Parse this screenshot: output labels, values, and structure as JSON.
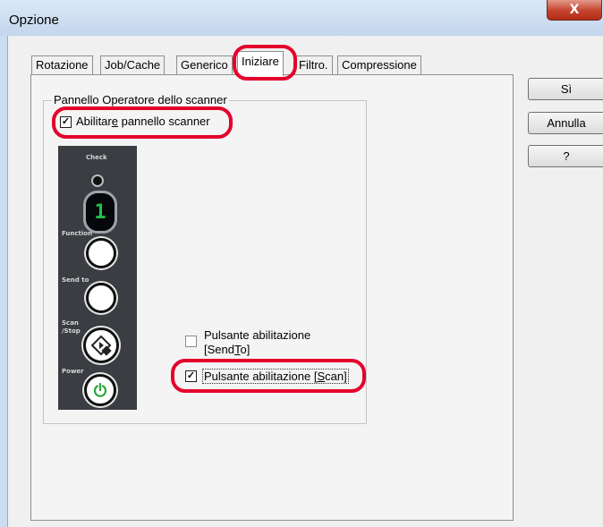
{
  "window": {
    "title": "Opzione",
    "close_glyph": "X"
  },
  "tabs": [
    {
      "label": "Rotazione",
      "active": false
    },
    {
      "label": "Job/Cache",
      "active": false
    },
    {
      "label": "Generico",
      "active": false
    },
    {
      "label": "Iniziare",
      "active": true
    },
    {
      "label": "Filtro.",
      "active": false
    },
    {
      "label": "Compressione",
      "active": false
    }
  ],
  "group": {
    "title": "Pannello Operatore dello scanner",
    "enable_panel": {
      "label_pre": "Abilitar",
      "label_mn": "e",
      "label_post": " pannello scanner",
      "checked": true
    }
  },
  "scanner_panel": {
    "labels": {
      "check": "Check",
      "function": "Function",
      "send_to": "Send to",
      "scan_stop_1": "Scan",
      "scan_stop_2": "/Stop",
      "power": "Power"
    },
    "display_digit": "1",
    "display_color": "#22c04a",
    "power_color": "#29a83c"
  },
  "options": {
    "sendto": {
      "line1": "Pulsante abilitazione",
      "line2_pre": "[Send",
      "line2_mn": "T",
      "line2_post": "o]",
      "checked": false
    },
    "scan": {
      "label_pre": "Pulsante abilitazione [",
      "label_mn": "S",
      "label_post": "can]",
      "checked": true
    }
  },
  "buttons": {
    "ok": "Sì",
    "cancel": "Annulla",
    "help": "?"
  },
  "highlight_color": "#e4002b"
}
